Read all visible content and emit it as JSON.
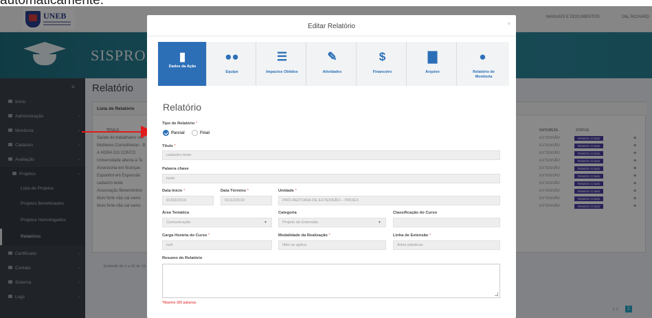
{
  "caption": "automaticamente.",
  "topbar": {
    "logo_name": "UNEB",
    "manuals": "MANUAIS E DOCUMENTOS",
    "user": "Olá, RICHARD"
  },
  "banner": {
    "title": "SISPROEX"
  },
  "sidebar": {
    "items": [
      {
        "label": "Início"
      },
      {
        "label": "Administração"
      },
      {
        "label": "Monitoria"
      },
      {
        "label": "Cadastro"
      },
      {
        "label": "Avaliação"
      },
      {
        "label": "Projetos"
      },
      {
        "label": "Lista de Projetos"
      },
      {
        "label": "Projetos Beneficiados"
      },
      {
        "label": "Projetos Homologados"
      },
      {
        "label": "Relatórios"
      },
      {
        "label": "Certificado"
      },
      {
        "label": "Contato"
      },
      {
        "label": "Sistema"
      },
      {
        "label": "Logs"
      }
    ]
  },
  "page": {
    "title": "Relatório",
    "panel_title": "Lista de Relatório",
    "col_title": "TÍTULO",
    "col_nature": "NATUREZA",
    "col_status": "STATUS",
    "rows": [
      {
        "title": "Saúde do trabalhador em",
        "nature": "EXTENSÃO",
        "status": "Relatório Criado"
      },
      {
        "title": "Mulheres Conselheiras - B",
        "nature": "EXTENSÃO",
        "status": "Relatório Criado"
      },
      {
        "title": "A HORA DO CONTO",
        "nature": "EXTENSÃO",
        "status": "Relatório Criado"
      },
      {
        "title": "Universidade aberta à Te",
        "nature": "EXTENSÃO",
        "status": "Relatório Criado"
      },
      {
        "title": "Assessoria em finanças",
        "nature": "EXTENSÃO",
        "status": "Relatório Criado"
      },
      {
        "title": "Espanhol em Expansão",
        "nature": "EXTENSÃO",
        "status": "Relatório Criado"
      },
      {
        "title": "cadastro teste",
        "nature": "EXTENSÃO",
        "status": "Relatório Criado"
      },
      {
        "title": "Associação Beneméritos",
        "nature": "EXTENSÃO",
        "status": "Relatório Criado"
      },
      {
        "title": "titulo forte não cai vamo",
        "nature": "EXTENSÃO",
        "status": "Relatório Criado"
      },
      {
        "title": "titulo forte não cai vamo",
        "nature": "EXTENSÃO",
        "status": "Relatório Criado"
      }
    ],
    "footer": "Exibindo de 1 a 10 de 10",
    "page_num": "1"
  },
  "modal": {
    "title": "Editar Relatório",
    "tabs": [
      {
        "label": "Dados da Ação",
        "icon": "book-icon"
      },
      {
        "label": "Equipe",
        "icon": "users-icon"
      },
      {
        "label": "Impactos Obtidos",
        "icon": "list-icon"
      },
      {
        "label": "Atividades",
        "icon": "edit-icon"
      },
      {
        "label": "Financeiro",
        "icon": "dollar-icon"
      },
      {
        "label": "Arquivo",
        "icon": "file-icon"
      },
      {
        "label": "Relatório de Monitoria",
        "icon": "user-icon"
      }
    ],
    "section_title": "Relatório",
    "tipo_label": "Tipo de Relatório",
    "radio_parcial": "Parcial",
    "radio_final": "Final",
    "titulo_label": "Título",
    "titulo_value": "cadastro teste",
    "palavra_label": "Palavra chave",
    "palavra_value": "teste",
    "data_inicio_label": "Data Início",
    "data_inicio_value": "01/03/2019",
    "data_termino_label": "Data Término",
    "data_termino_value": "01/12/2019",
    "unidade_label": "Unidade",
    "unidade_value": "PRÓ-REITORIA DE EXTENSÃO – PROEX",
    "area_label": "Área Temática",
    "area_value": "Comunicação",
    "categoria_label": "Categoria",
    "categoria_value": "Projeto de Extensão",
    "classificacao_label": "Classificação do Curso",
    "carga_label": "Carga Horária do Curso",
    "carga_value": "null",
    "modalidade_label": "Modalidade da Realização",
    "modalidade_value": "Não se aplica",
    "linha_label": "Linha de Extensão",
    "linha_value": "Artes plásticas",
    "resumo_label": "Resumo do Relatório",
    "limit_note": "*Maximo 300 palavras",
    "required_mark": "*"
  },
  "colors": {
    "accent": "#2c6fb7",
    "arrow": "#e01b1b",
    "badge": "#4b3fa3"
  }
}
